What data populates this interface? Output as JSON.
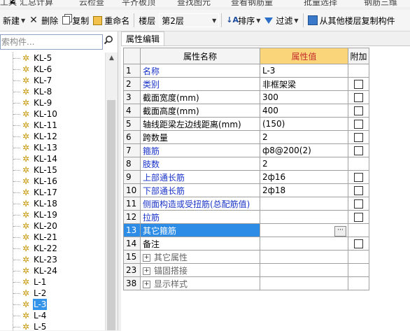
{
  "top_strip": [
    "工具",
    "汇总计算",
    "云检查",
    "平齐板顶",
    "查找图元",
    "查看钢筋量",
    "批量选择",
    "钢筋三维"
  ],
  "toolbar": {
    "new_label": "新建",
    "delete_label": "删除",
    "copy_label": "复制",
    "rename_label": "重命名",
    "floor_label": "楼层",
    "floor_value": "第2层",
    "sort_label": "排序",
    "filter_label": "过滤",
    "copy_from_floor_label": "从其他楼层复制构件"
  },
  "search": {
    "placeholder": "索构件..."
  },
  "tree": {
    "items": [
      "KL-5",
      "KL-6",
      "KL-7",
      "KL-8",
      "KL-9",
      "KL-10",
      "KL-11",
      "KL-12",
      "KL-13",
      "KL-14",
      "KL-15",
      "KL-16",
      "KL-17",
      "KL-18",
      "KL-19",
      "KL-20",
      "KL-21",
      "KL-22",
      "KL-23",
      "KL-24",
      "L-1",
      "L-2",
      "L-3",
      "L-4",
      "L-5"
    ],
    "selected": "L-3"
  },
  "tab": {
    "label": "属性编辑"
  },
  "grid": {
    "headers": {
      "name": "属性名称",
      "value": "属性值",
      "add": "附加"
    },
    "rows": [
      {
        "num": "1",
        "name": "名称",
        "value": "L-3",
        "color": "blue",
        "checkbox": false
      },
      {
        "num": "2",
        "name": "类别",
        "value": "非框架梁",
        "color": "blue",
        "checkbox": true
      },
      {
        "num": "3",
        "name": "截面宽度(mm)",
        "value": "300",
        "color": "black",
        "checkbox": true
      },
      {
        "num": "4",
        "name": "截面高度(mm)",
        "value": "400",
        "color": "black",
        "checkbox": true
      },
      {
        "num": "5",
        "name": "轴线距梁左边线距离(mm)",
        "value": "(150)",
        "color": "black",
        "checkbox": true
      },
      {
        "num": "6",
        "name": "跨数量",
        "value": "2",
        "color": "black",
        "checkbox": true
      },
      {
        "num": "7",
        "name": "箍筋",
        "value": "ф8@200(2)",
        "color": "blue",
        "checkbox": true
      },
      {
        "num": "8",
        "name": "肢数",
        "value": "2",
        "color": "blue",
        "checkbox": false
      },
      {
        "num": "9",
        "name": "上部通长筋",
        "value": "2ф16",
        "color": "blue",
        "checkbox": true
      },
      {
        "num": "10",
        "name": "下部通长筋",
        "value": "2ф18",
        "color": "blue",
        "checkbox": true
      },
      {
        "num": "11",
        "name": "侧面构造或受扭筋(总配筋值)",
        "value": "",
        "color": "blue",
        "checkbox": true
      },
      {
        "num": "12",
        "name": "拉筋",
        "value": "",
        "color": "blue",
        "checkbox": true
      },
      {
        "num": "13",
        "name": "其它箍筋",
        "value": "",
        "color": "selected",
        "checkbox": false
      },
      {
        "num": "14",
        "name": "备注",
        "value": "",
        "color": "black",
        "checkbox": true
      },
      {
        "num": "15",
        "name": "其它属性",
        "value": "",
        "color": "gray",
        "checkbox": false,
        "group": true
      },
      {
        "num": "23",
        "name": "锚固搭接",
        "value": "",
        "color": "gray",
        "checkbox": false,
        "group": true
      },
      {
        "num": "38",
        "name": "显示样式",
        "value": "",
        "color": "gray",
        "checkbox": false,
        "group": true
      }
    ]
  }
}
